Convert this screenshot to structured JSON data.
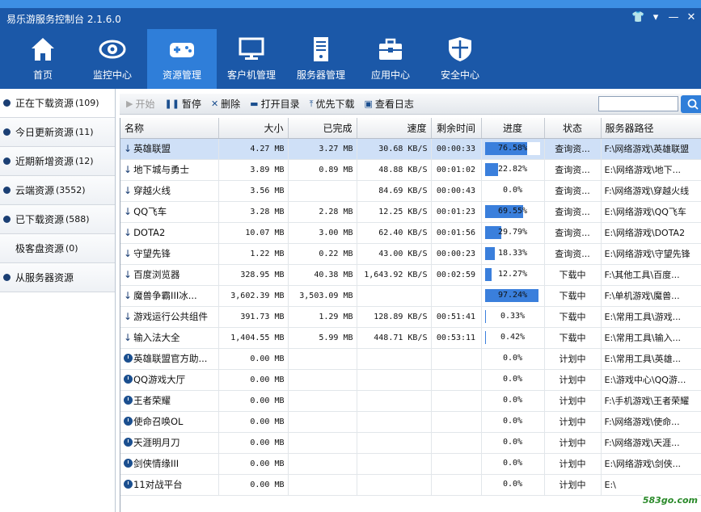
{
  "app": {
    "title": "易乐游服务控制台 2.1.6.0"
  },
  "window_controls": {
    "shirt": "👕",
    "menu": "▾",
    "minimize": "—",
    "close": "✕"
  },
  "nav": [
    {
      "label": "首页",
      "icon": "home-icon"
    },
    {
      "label": "监控中心",
      "icon": "eye-icon"
    },
    {
      "label": "资源管理",
      "icon": "gamepad-icon",
      "active": true
    },
    {
      "label": "客户机管理",
      "icon": "monitor-icon"
    },
    {
      "label": "服务器管理",
      "icon": "server-icon"
    },
    {
      "label": "应用中心",
      "icon": "toolbox-icon"
    },
    {
      "label": "安全中心",
      "icon": "shield-icon"
    }
  ],
  "sidebar": [
    {
      "label": "正在下载资源",
      "count": "(109)",
      "active": true
    },
    {
      "label": "今日更新资源",
      "count": "(11)"
    },
    {
      "label": "近期新增资源",
      "count": "(12)"
    },
    {
      "label": "云端资源",
      "count": "(3552)"
    },
    {
      "label": "已下载资源",
      "count": "(588)"
    },
    {
      "label": "极客盘资源",
      "count": "(0)",
      "no_dot": true
    },
    {
      "label": "从服务器资源",
      "count": ""
    }
  ],
  "toolbar": {
    "start": "开始",
    "pause": "暂停",
    "delete": "删除",
    "open_dir": "打开目录",
    "priority": "优先下载",
    "log": "查看日志",
    "search_value": ""
  },
  "table": {
    "headers": [
      "名称",
      "大小",
      "已完成",
      "速度",
      "剩余时间",
      "进度",
      "状态",
      "服务器路径"
    ],
    "rows": [
      {
        "icon": "download-arrow",
        "name": "英雄联盟",
        "size": "4.27 MB",
        "done": "3.27 MB",
        "speed": "30.68 KB/S",
        "remain": "00:00:33",
        "progress": "76.58%",
        "pct": 76.58,
        "status": "查询资...",
        "path": "F:\\网络游戏\\英雄联盟",
        "selected": true
      },
      {
        "icon": "download-arrow",
        "name": "地下城与勇士",
        "size": "3.89 MB",
        "done": "0.89 MB",
        "speed": "48.88 KB/S",
        "remain": "00:01:02",
        "progress": "22.82%",
        "pct": 22.82,
        "status": "查询资...",
        "path": "E:\\网络游戏\\地下..."
      },
      {
        "icon": "download-arrow",
        "name": "穿越火线",
        "size": "3.56 MB",
        "done": "",
        "speed": "84.69 KB/S",
        "remain": "00:00:43",
        "progress": "0.0%",
        "pct": 0,
        "status": "查询资...",
        "path": "F:\\网络游戏\\穿越火线"
      },
      {
        "icon": "download-arrow",
        "name": "QQ飞车",
        "size": "3.28 MB",
        "done": "2.28 MB",
        "speed": "12.25 KB/S",
        "remain": "00:01:23",
        "progress": "69.55%",
        "pct": 69.55,
        "status": "查询资...",
        "path": "E:\\网络游戏\\QQ飞车"
      },
      {
        "icon": "download-arrow",
        "name": "DOTA2",
        "size": "10.07 MB",
        "done": "3.00 MB",
        "speed": "62.40 KB/S",
        "remain": "00:01:56",
        "progress": "29.79%",
        "pct": 29.79,
        "status": "查询资...",
        "path": "E:\\网络游戏\\DOTA2"
      },
      {
        "icon": "download-arrow",
        "name": "守望先锋",
        "size": "1.22 MB",
        "done": "0.22 MB",
        "speed": "43.00 KB/S",
        "remain": "00:00:23",
        "progress": "18.33%",
        "pct": 18.33,
        "status": "查询资...",
        "path": "E:\\网络游戏\\守望先锋"
      },
      {
        "icon": "download-arrow",
        "name": "百度浏览器",
        "size": "328.95 MB",
        "done": "40.38 MB",
        "speed": "1,643.92 KB/S",
        "remain": "00:02:59",
        "progress": "12.27%",
        "pct": 12.27,
        "status": "下载中",
        "path": "F:\\其他工具\\百度..."
      },
      {
        "icon": "download-arrow",
        "name": "魔兽争霸III冰...",
        "size": "3,602.39 MB",
        "done": "3,503.09 MB",
        "speed": "",
        "remain": "",
        "progress": "97.24%",
        "pct": 97.24,
        "status": "下载中",
        "path": "F:\\单机游戏\\魔兽..."
      },
      {
        "icon": "download-arrow",
        "name": "游戏运行公共组件",
        "size": "391.73 MB",
        "done": "1.29 MB",
        "speed": "128.89 KB/S",
        "remain": "00:51:41",
        "progress": "0.33%",
        "pct": 0.33,
        "status": "下载中",
        "path": "E:\\常用工具\\游戏..."
      },
      {
        "icon": "download-arrow",
        "name": "输入法大全",
        "size": "1,404.55 MB",
        "done": "5.99 MB",
        "speed": "448.71 KB/S",
        "remain": "00:53:11",
        "progress": "0.42%",
        "pct": 0.42,
        "status": "下载中",
        "path": "E:\\常用工具\\输入..."
      },
      {
        "icon": "clock",
        "name": "英雄联盟官方助...",
        "size": "0.00 MB",
        "done": "",
        "speed": "",
        "remain": "",
        "progress": "0.0%",
        "pct": 0,
        "status": "计划中",
        "path": "E:\\常用工具\\英雄..."
      },
      {
        "icon": "clock",
        "name": "QQ游戏大厅",
        "size": "0.00 MB",
        "done": "",
        "speed": "",
        "remain": "",
        "progress": "0.0%",
        "pct": 0,
        "status": "计划中",
        "path": "E:\\游戏中心\\QQ游..."
      },
      {
        "icon": "clock",
        "name": "王者荣耀",
        "size": "0.00 MB",
        "done": "",
        "speed": "",
        "remain": "",
        "progress": "0.0%",
        "pct": 0,
        "status": "计划中",
        "path": "F:\\手机游戏\\王者荣耀"
      },
      {
        "icon": "clock",
        "name": "使命召唤OL",
        "size": "0.00 MB",
        "done": "",
        "speed": "",
        "remain": "",
        "progress": "0.0%",
        "pct": 0,
        "status": "计划中",
        "path": "F:\\网络游戏\\使命..."
      },
      {
        "icon": "clock",
        "name": "天涯明月刀",
        "size": "0.00 MB",
        "done": "",
        "speed": "",
        "remain": "",
        "progress": "0.0%",
        "pct": 0,
        "status": "计划中",
        "path": "F:\\网络游戏\\天涯..."
      },
      {
        "icon": "clock",
        "name": "剑侠情缘III",
        "size": "0.00 MB",
        "done": "",
        "speed": "",
        "remain": "",
        "progress": "0.0%",
        "pct": 0,
        "status": "计划中",
        "path": "E:\\网络游戏\\剑侠..."
      },
      {
        "icon": "clock",
        "name": "11对战平台",
        "size": "0.00 MB",
        "done": "",
        "speed": "",
        "remain": "",
        "progress": "0.0%",
        "pct": 0,
        "status": "计划中",
        "path": "E:\\"
      }
    ]
  },
  "watermark": "583go.com"
}
